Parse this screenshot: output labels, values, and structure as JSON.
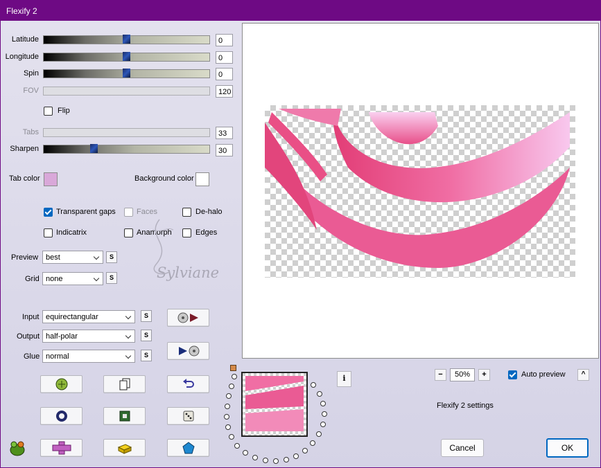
{
  "window": {
    "title": "Flexify 2"
  },
  "sliders": [
    {
      "id": "latitude",
      "label": "Latitude",
      "value": "0",
      "fraction": 0.5,
      "enabled": true
    },
    {
      "id": "longitude",
      "label": "Longitude",
      "value": "0",
      "fraction": 0.5,
      "enabled": true
    },
    {
      "id": "spin",
      "label": "Spin",
      "value": "0",
      "fraction": 0.5,
      "enabled": true
    },
    {
      "id": "fov",
      "label": "FOV",
      "value": "120",
      "fraction": null,
      "enabled": false
    },
    {
      "id": "tabs",
      "label": "Tabs",
      "value": "33",
      "fraction": null,
      "enabled": false
    },
    {
      "id": "sharpen",
      "label": "Sharpen",
      "value": "30",
      "fraction": 0.3,
      "enabled": true
    }
  ],
  "flip": {
    "label": "Flip",
    "checked": false
  },
  "colors": {
    "tab_color_label": "Tab color",
    "tab_color": "#d9a8d9",
    "background_color_label": "Background color",
    "background_color": "#ffffff"
  },
  "options": {
    "transparent_gaps": {
      "label": "Transparent gaps",
      "checked": true
    },
    "faces": {
      "label": "Faces",
      "checked": false,
      "enabled": false
    },
    "de_halo": {
      "label": "De-halo",
      "checked": false
    },
    "indicatrix": {
      "label": "Indicatrix",
      "checked": false
    },
    "anamorph": {
      "label": "Anamorph",
      "checked": false
    },
    "edges": {
      "label": "Edges",
      "checked": false
    }
  },
  "preview_select": {
    "label": "Preview",
    "value": "best"
  },
  "grid_select": {
    "label": "Grid",
    "value": "none"
  },
  "input_select": {
    "label": "Input",
    "value": "equirectangular"
  },
  "output_select": {
    "label": "Output",
    "value": "half-polar"
  },
  "glue_select": {
    "label": "Glue",
    "value": "normal"
  },
  "swap_label": "S",
  "watermark": "Sylviane",
  "zoom": {
    "value": "50%",
    "minus": "−",
    "plus": "+"
  },
  "auto_preview": {
    "label": "Auto preview",
    "checked": true,
    "caret": "^"
  },
  "info_label": "i",
  "settings_label": "Flexify 2 settings",
  "buttons": {
    "cancel": "Cancel",
    "ok": "OK"
  },
  "accent": "#0067c0",
  "title_color": "#6e0a84",
  "icons": [
    "randomize-icon",
    "copy-icon",
    "undo-icon",
    "ring-icon",
    "square-frame-icon",
    "dice-icon",
    "plus-cross-icon",
    "brick-icon",
    "pentagon-icon",
    "camera-forward-icon",
    "play-camera-icon",
    "frog-logo-icon"
  ]
}
